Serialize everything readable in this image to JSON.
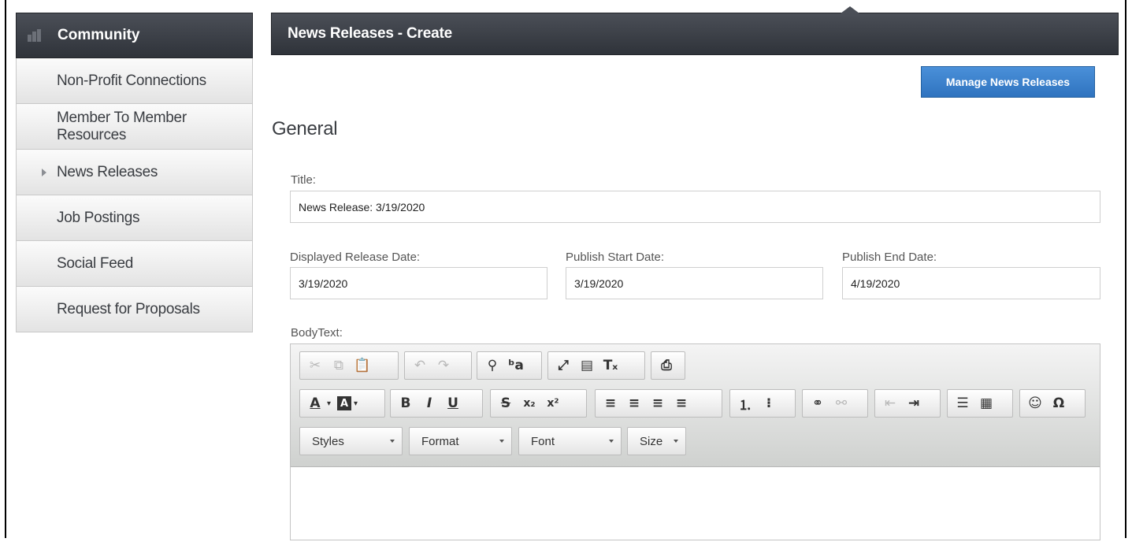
{
  "sidebar": {
    "header": "Community",
    "items": [
      {
        "label": "Non-Profit Connections"
      },
      {
        "label": "Member To Member Resources"
      },
      {
        "label": "News Releases"
      },
      {
        "label": "Job Postings"
      },
      {
        "label": "Social Feed"
      },
      {
        "label": "Request for Proposals"
      }
    ]
  },
  "header": {
    "title": "News Releases - Create"
  },
  "manage_button": "Manage News Releases",
  "section": "General",
  "form": {
    "title_label": "Title:",
    "title_value": "News Release: 3/19/2020",
    "release_label": "Displayed Release Date:",
    "release_value": "3/19/2020",
    "start_label": "Publish Start Date:",
    "start_value": "3/19/2020",
    "end_label": "Publish End Date:",
    "end_value": "4/19/2020",
    "body_label": "BodyText:"
  },
  "editor": {
    "combos": {
      "styles": "Styles",
      "format": "Format",
      "font": "Font",
      "size": "Size"
    },
    "glyphs": {
      "cut": "✂",
      "copy": "⧉",
      "paste_text": "📋",
      "undo": "↶",
      "redo": "↷",
      "find": "⚲",
      "replace": "ᵇa",
      "maximize": "⤢",
      "show_blocks": "▤",
      "remove_format": "Tₓ",
      "print": "⎙",
      "text_color": "A",
      "bg_color": "A",
      "bold": "B",
      "italic": "I",
      "underline": "U",
      "strike": "S",
      "subscript": "x₂",
      "superscript": "x²",
      "align_left": "≡",
      "align_center": "≡",
      "align_right": "≡",
      "justify": "≡",
      "numbered_list": "⒈",
      "bullet_list": "⁝",
      "link": "⚭",
      "unlink": "⚯",
      "outdent": "⇤",
      "indent": "⇥",
      "horizontal_line": "☰",
      "table": "▦",
      "smiley": "☺",
      "special_char": "Ω"
    }
  }
}
